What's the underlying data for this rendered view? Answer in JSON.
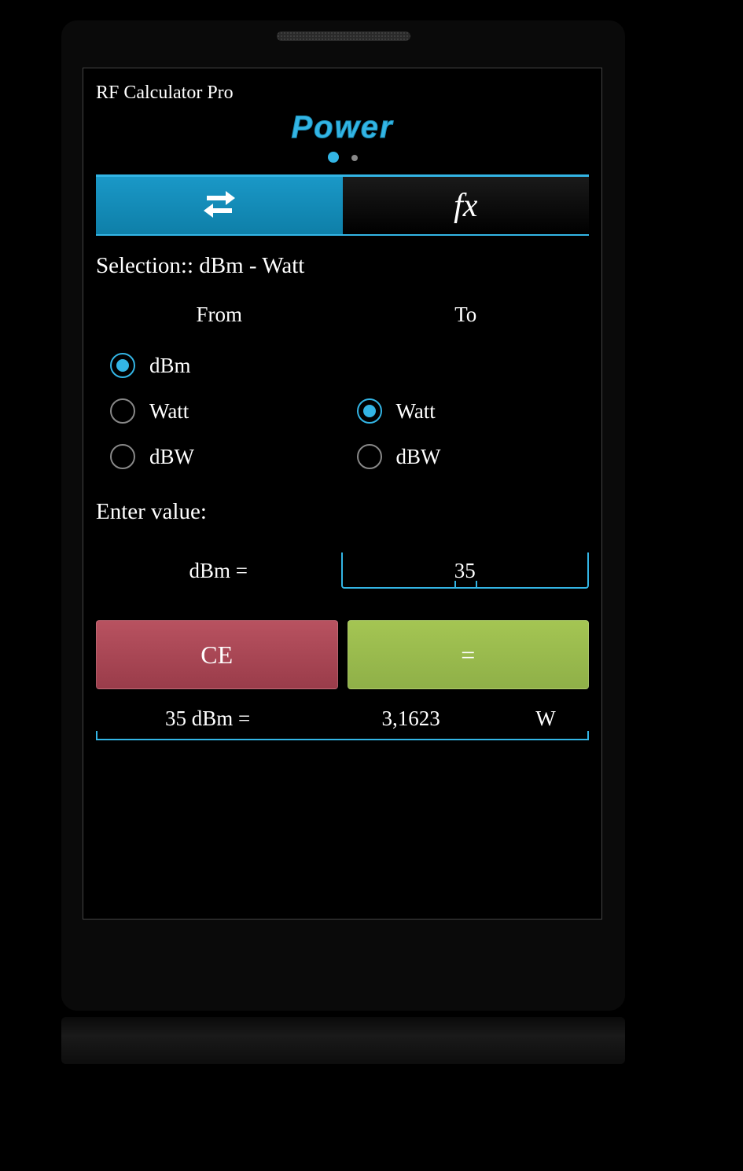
{
  "app": {
    "title": "RF Calculator Pro",
    "page_title": "Power"
  },
  "tabs": {
    "convert_icon": "swap-icon",
    "fx_icon": "fx"
  },
  "selection": {
    "label": "Selection:: dBm - Watt"
  },
  "columns": {
    "from_header": "From",
    "to_header": "To"
  },
  "from_options": [
    {
      "label": "dBm",
      "selected": true
    },
    {
      "label": "Watt",
      "selected": false
    },
    {
      "label": "dBW",
      "selected": false
    }
  ],
  "to_options": [
    {
      "label": "Watt",
      "selected": true
    },
    {
      "label": "dBW",
      "selected": false
    }
  ],
  "enter": {
    "label": "Enter value:",
    "unit_label": "dBm =",
    "value": "35"
  },
  "buttons": {
    "ce": "CE",
    "eq": "="
  },
  "result": {
    "label": "35 dBm =",
    "value": "3,1623",
    "unit": "W"
  }
}
